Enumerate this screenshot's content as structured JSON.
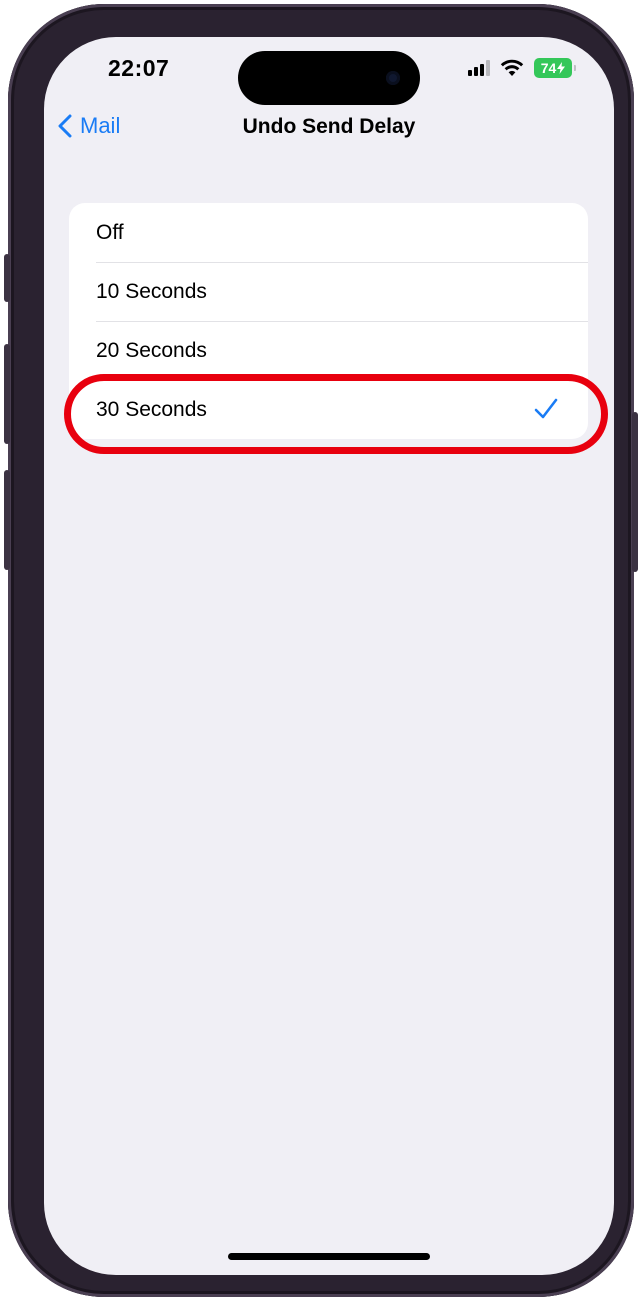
{
  "status_bar": {
    "time": "22:07",
    "battery_level": "74",
    "signal_icon": "cellular-signal-icon",
    "wifi_icon": "wifi-icon"
  },
  "nav": {
    "back_label": "Mail",
    "title": "Undo Send Delay"
  },
  "options": [
    {
      "label": "Off",
      "selected": false
    },
    {
      "label": "10 Seconds",
      "selected": false
    },
    {
      "label": "20 Seconds",
      "selected": false
    },
    {
      "label": "30 Seconds",
      "selected": true
    }
  ],
  "colors": {
    "accent": "#1a7cf5",
    "highlight_ring": "#e8000e",
    "battery": "#34c759",
    "background": "#f0eff5"
  }
}
